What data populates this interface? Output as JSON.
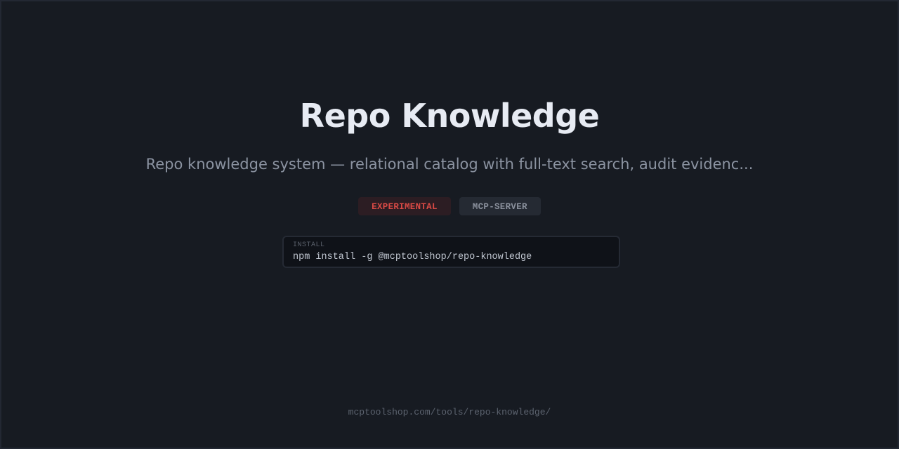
{
  "title": "Repo Knowledge",
  "subtitle": "Repo knowledge system — relational catalog with full-text search, audit evidenc...",
  "badges": [
    {
      "label": "EXPERIMENTAL",
      "color": "#d94a45"
    },
    {
      "label": "MCP-SERVER",
      "color": "#8a909c"
    }
  ],
  "install": {
    "label": "INSTALL",
    "command": "npm install -g @mcptoolshop/repo-knowledge"
  },
  "footer_url": "mcptoolshop.com/tools/repo-knowledge/",
  "colors": {
    "background": "#171b22",
    "title": "#e7ebf3",
    "subtitle": "#8b93a1",
    "experimental_badge": "#d94a45",
    "install_box": "#0f1218"
  }
}
